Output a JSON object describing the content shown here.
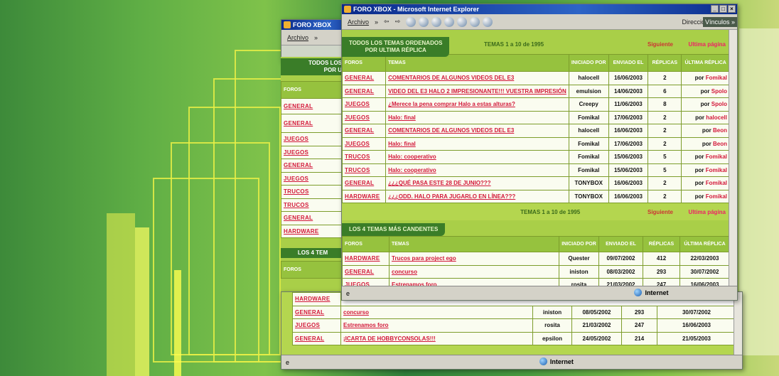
{
  "browser": {
    "title": "FORO XBOX - Microsoft Internet Explorer",
    "title_short": "FORO XBOX",
    "menu": {
      "archivo": "Archivo",
      "more": "»",
      "direccion": "Dirección",
      "vinculos": "Vínculos »"
    },
    "status": {
      "zone": "Internet"
    }
  },
  "section1": {
    "title_line1": "TODOS LOS TEMAS ORDENADOS",
    "title_line2": "POR ULTIMA RÉPLICA",
    "pagination": "TEMAS 1 a 10 de 1995",
    "link1": "Siguiente",
    "link2": "Ultima página",
    "headers": [
      "FOROS",
      "TEMAS",
      "INICIADO POR",
      "ENVIADO EL",
      "RÉPLICAS",
      "ÚLTIMA RÉPLICA"
    ],
    "rows": [
      {
        "foro": "GENERAL",
        "tema": "COMENTARIOS DE ALGUNOS VIDEOS DEL E3",
        "autor": "halocell",
        "fecha": "16/06/2003",
        "replicas": "2",
        "ultima": "Fomikal"
      },
      {
        "foro": "GENERAL",
        "tema": "VIDEO DEL E3 HALO 2 IMPRESIONANTE!!! VUESTRA IMPRESIÓN",
        "autor": "emulsion",
        "fecha": "14/06/2003",
        "replicas": "6",
        "ultima": "Spolo"
      },
      {
        "foro": "JUEGOS",
        "tema": "¿Merece la pena comprar Halo a estas alturas?",
        "autor": "Creepy",
        "fecha": "11/06/2003",
        "replicas": "8",
        "ultima": "Spolo"
      },
      {
        "foro": "JUEGOS",
        "tema": "Halo: final",
        "autor": "Fomikal",
        "fecha": "17/06/2003",
        "replicas": "2",
        "ultima": "halocell"
      },
      {
        "foro": "GENERAL",
        "tema": "COMENTARIOS DE ALGUNOS VIDEOS DEL E3",
        "autor": "halocell",
        "fecha": "16/06/2003",
        "replicas": "2",
        "ultima": "Beon"
      },
      {
        "foro": "JUEGOS",
        "tema": "Halo: final",
        "autor": "Fomikal",
        "fecha": "17/06/2003",
        "replicas": "2",
        "ultima": "Beon"
      },
      {
        "foro": "TRUCOS",
        "tema": "Halo: cooperativo",
        "autor": "Fomikal",
        "fecha": "15/06/2003",
        "replicas": "5",
        "ultima": "Fomikal"
      },
      {
        "foro": "TRUCOS",
        "tema": "Halo: cooperativo",
        "autor": "Fomikal",
        "fecha": "15/06/2003",
        "replicas": "5",
        "ultima": "Fomikal"
      },
      {
        "foro": "GENERAL",
        "tema": "¿¿¿QUÉ PASA ESTE 28 DE JUNIO???",
        "autor": "TONYBOX",
        "fecha": "16/06/2003",
        "replicas": "2",
        "ultima": "Fomikal"
      },
      {
        "foro": "HARDWARE",
        "tema": "¿¿¿ODD. HALO PARA JUGARLO EN LÍNEA???",
        "autor": "TONYBOX",
        "fecha": "16/06/2003",
        "replicas": "2",
        "ultima": "Fomikal"
      }
    ],
    "por": "por"
  },
  "section2": {
    "title": "LOS 4 TEMAS MÁS CANDENTES",
    "headers": [
      "FOROS",
      "TEMAS",
      "INICIADO POR",
      "ENVIADO EL",
      "RÉPLICAS",
      "ÚLTIMA RÉPLICA"
    ],
    "rows": [
      {
        "foro": "HARDWARE",
        "tema": "Trucos para project ego",
        "autor": "Quester",
        "fecha": "09/07/2002",
        "replicas": "412",
        "ultima": "22/03/2003"
      },
      {
        "foro": "GENERAL",
        "tema": "concurso",
        "autor": "iniston",
        "fecha": "08/03/2002",
        "replicas": "293",
        "ultima": "30/07/2002"
      },
      {
        "foro": "JUEGOS",
        "tema": "Estrenamos foro",
        "autor": "rosita",
        "fecha": "21/03/2002",
        "replicas": "247",
        "ultima": "16/06/2003"
      },
      {
        "foro": "GENERAL",
        "tema": "¡ICARTA DE HOBBYCONSOLAS!!!",
        "autor": "epsilon",
        "fecha": "24/05/2002",
        "replicas": "214",
        "ultima": "21/05/2003"
      }
    ]
  },
  "back_left": {
    "title_line1": "TODOS LOS",
    "title_line2": "POR U",
    "foros_header": "FOROS",
    "foros": [
      "GENERAL",
      "GENERAL",
      "JUEGOS",
      "JUEGOS",
      "GENERAL",
      "JUEGOS",
      "TRUCOS",
      "TRUCOS",
      "GENERAL",
      "HARDWARE"
    ],
    "sec2_title": "LOS 4 TEM",
    "sec2_header": "FOROS"
  },
  "back_rows": [
    {
      "foro": "HARDWARE",
      "tema": "",
      "autor": "",
      "fecha": "",
      "replicas": "",
      "ultima": ""
    },
    {
      "foro": "GENERAL",
      "tema": "concurso",
      "autor": "iniston",
      "fecha": "08/05/2002",
      "replicas": "293",
      "ultima": "30/07/2002"
    },
    {
      "foro": "JUEGOS",
      "tema": "Estrenamos foro",
      "autor": "rosita",
      "fecha": "21/03/2002",
      "replicas": "247",
      "ultima": "16/06/2003"
    },
    {
      "foro": "GENERAL",
      "tema": "¡ICARTA DE HOBBYCONSOLAS!!!",
      "autor": "epsilon",
      "fecha": "24/05/2002",
      "replicas": "214",
      "ultima": "21/05/2003"
    }
  ],
  "colors": {
    "accent": "#d3183a",
    "header_green": "#3a7d28",
    "page_green": "#b4d64f",
    "titlebar": "#0a2a8a"
  }
}
